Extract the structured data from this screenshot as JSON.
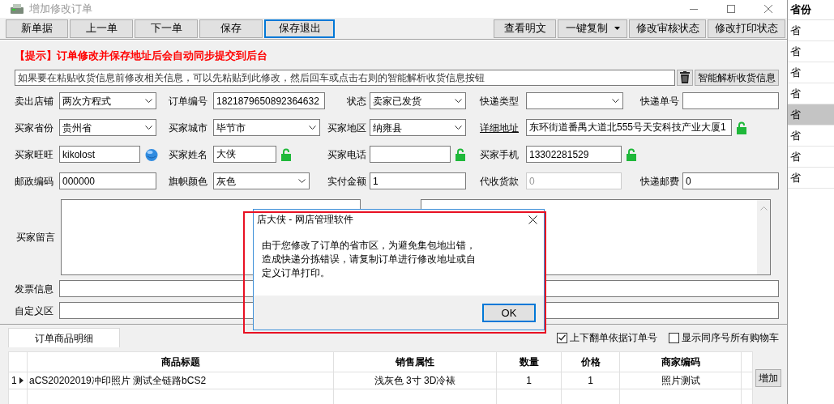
{
  "window": {
    "title": "增加修改订单"
  },
  "toolbar_left": [
    {
      "label": "新单据",
      "focused": false
    },
    {
      "label": "上一单",
      "focused": false
    },
    {
      "label": "下一单",
      "focused": false
    },
    {
      "label": "保存",
      "focused": false
    },
    {
      "label": "保存退出",
      "focused": true
    }
  ],
  "toolbar_right": [
    {
      "label": "查看明文",
      "kind": "button"
    },
    {
      "label": "一键复制",
      "kind": "split"
    },
    {
      "label": "修改审核状态",
      "kind": "button"
    },
    {
      "label": "修改打印状态",
      "kind": "button"
    }
  ],
  "notice": "【提示】订单修改并保存地址后会自动同步提交到后台",
  "paste_box": {
    "placeholder": "如果要在粘贴收货信息前修改相关信息，可以先粘贴到此修改，然后回车或点击右则的智能解析收货信息按钮"
  },
  "parse_button": "智能解析收货信息",
  "form_rows": [
    [
      {
        "label": "卖出店铺",
        "kind": "select",
        "value": "两次方程式"
      },
      {
        "label": "订单编号",
        "kind": "text",
        "value": "1821879650892364632",
        "disabled": false
      },
      {
        "label": "状态",
        "kind": "select",
        "value": "卖家已发货"
      },
      {
        "label": "快递类型",
        "kind": "select"
      },
      {
        "label": "快递单号",
        "kind": "text",
        "disabled": false
      }
    ],
    [
      {
        "label": "买家省份",
        "kind": "select",
        "value": "贵州省"
      },
      {
        "label": "买家城市",
        "kind": "select",
        "value": "毕节市"
      },
      {
        "label": "买家地区",
        "kind": "select",
        "value": "纳雍县"
      },
      {
        "label": "详细地址",
        "kind": "text",
        "value": "东环街道番禺大道北555号天安科技产业大厦1",
        "link": true,
        "has_lock": true,
        "disabled": false
      }
    ],
    [
      {
        "label": "买家旺旺",
        "kind": "text",
        "value": "kikolost",
        "has_chat": true,
        "disabled": false
      },
      {
        "label": "买家姓名",
        "kind": "text",
        "value": "大侠",
        "has_lock": true,
        "disabled": false
      },
      {
        "label": "买家电话",
        "kind": "text",
        "has_lock": true,
        "disabled": false
      },
      {
        "label": "买家手机",
        "kind": "text",
        "value": "13302281529",
        "has_lock": true,
        "disabled": false
      }
    ],
    [
      {
        "label": "邮政编码",
        "kind": "text",
        "value": "000000",
        "disabled": false
      },
      {
        "label": "旗帜颜色",
        "kind": "select",
        "value": "灰色"
      },
      {
        "label": "实付金额",
        "kind": "text",
        "value": "1",
        "disabled": false
      },
      {
        "label": "代收货款",
        "kind": "text",
        "value": "0",
        "disabled": true
      },
      {
        "label": "快递邮费",
        "kind": "text",
        "value": "0",
        "disabled": false
      }
    ]
  ],
  "message_label": "买家留言",
  "invoice_label": "发票信息",
  "custom_label": "自定义区",
  "detail_tabs": [
    {
      "label": "订单商品明细",
      "selected": true
    }
  ],
  "options": [
    {
      "label": "上下翻单依据订单号",
      "checked": true
    },
    {
      "label": "显示同序号所有购物车",
      "checked": false
    }
  ],
  "table": {
    "columns": [
      "商品标题",
      "销售属性",
      "数量",
      "价格",
      "商家编码"
    ],
    "rows": [
      {
        "index": "1",
        "current": true,
        "cells": [
          "aCS20202019冲印照片  测试全链路bCS2",
          "浅灰色 3寸 3D冷裱",
          "1",
          "1",
          "照片测试"
        ]
      }
    ]
  },
  "add_button": "增加",
  "dialog": {
    "title": "店大侠 - 网店管理软件",
    "message": "由于您修改了订单的省市区，为避免集包地出错，造成快递分拣错误，请复制订单进行修改地址或自定义订单打印。",
    "ok": "OK"
  },
  "background_list": {
    "header": "省份",
    "rows": [
      {
        "text": "省",
        "selected": false
      },
      {
        "text": "省",
        "selected": false
      },
      {
        "text": "省",
        "selected": false
      },
      {
        "text": "省",
        "selected": false
      },
      {
        "text": "省",
        "selected": true
      },
      {
        "text": "省",
        "selected": false
      },
      {
        "text": "省",
        "selected": false
      },
      {
        "text": "省",
        "selected": false
      }
    ]
  }
}
